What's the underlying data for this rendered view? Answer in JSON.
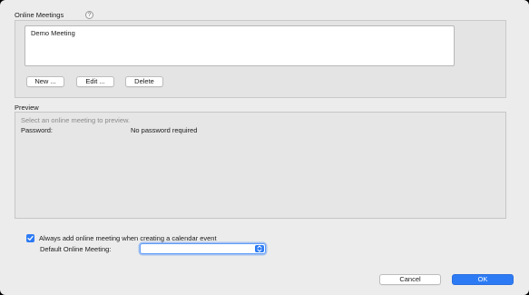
{
  "online_meetings": {
    "title": "Online Meetings",
    "help_glyph": "?",
    "items": [
      "Demo Meeting"
    ],
    "new_label": "New ...",
    "edit_label": "Edit ...",
    "delete_label": "Delete"
  },
  "preview": {
    "title": "Preview",
    "hint": "Select an online meeting to preview.",
    "password_label": "Password:",
    "password_value": "No password required"
  },
  "options": {
    "always_add_label": "Always add online meeting when creating a calendar event",
    "always_add_checked": true,
    "default_label": "Default Online Meeting:",
    "default_value": ""
  },
  "footer": {
    "cancel_label": "Cancel",
    "ok_label": "OK"
  },
  "colors": {
    "accent": "#2d7bf4",
    "background": "#ececec"
  }
}
